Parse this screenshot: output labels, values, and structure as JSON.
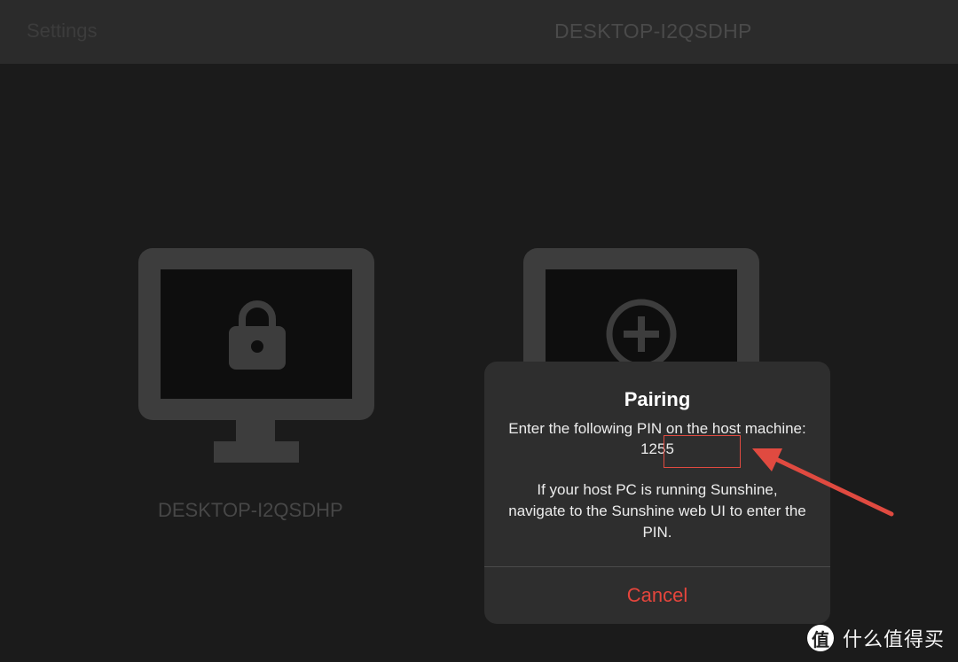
{
  "topbar": {
    "settings_label": "Settings",
    "title": "DESKTOP-I2QSDHP"
  },
  "hosts": [
    {
      "name": "DESKTOP-I2QSDHP",
      "status_icon": "lock-icon"
    },
    {
      "name": "",
      "status_icon": "add-icon"
    }
  ],
  "dialog": {
    "title": "Pairing",
    "message_prefix": "Enter the following PIN on the host machine:",
    "pin": "1255",
    "message_secondary": "If your host PC is running Sunshine, navigate to the Sunshine web UI to enter the PIN.",
    "cancel_label": "Cancel"
  },
  "colors": {
    "background": "#1b1b1b",
    "topbar": "#2b2b2b",
    "monitor": "#3d3d3d",
    "dialog": "#2e2e2e",
    "cancel": "#e5453c",
    "annotation": "#e04a40"
  },
  "watermark": {
    "logo_glyph": "值",
    "text": "什么值得买"
  }
}
